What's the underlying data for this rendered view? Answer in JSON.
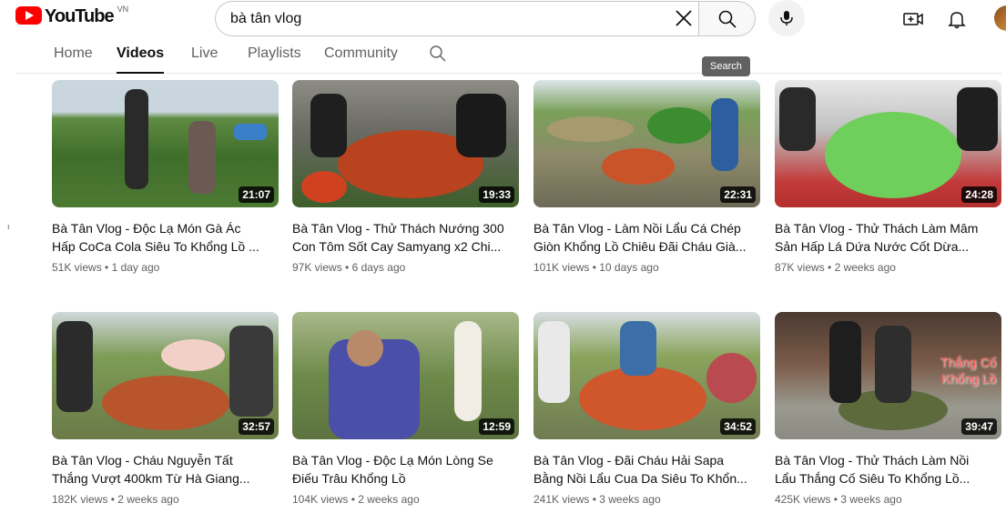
{
  "header": {
    "logo_text": "YouTube",
    "region": "VN",
    "search_value": "bà tân vlog",
    "search_tooltip": "Search"
  },
  "tabs": [
    {
      "label": "Home"
    },
    {
      "label": "Videos"
    },
    {
      "label": "Live"
    },
    {
      "label": "Playlists"
    },
    {
      "label": "Community"
    }
  ],
  "videos": [
    {
      "title": "Bà Tân Vlog - Độc Lạ Món Gà Ác Hấp CoCa Cola Siêu To Khổng Lồ ...",
      "duration": "21:07",
      "views": "51K views",
      "age": "1 day ago"
    },
    {
      "title": "Bà Tân Vlog - Thử Thách Nướng 300 Con Tôm Sốt Cay Samyang x2 Chi...",
      "duration": "19:33",
      "views": "97K views",
      "age": "6 days ago"
    },
    {
      "title": "Bà Tân Vlog - Làm Nồi Lẩu Cá Chép Giòn Khổng Lồ Chiêu Đãi Cháu Già...",
      "duration": "22:31",
      "views": "101K views",
      "age": "10 days ago"
    },
    {
      "title": "Bà Tân Vlog - Thử Thách Làm Mâm Sản Hấp Lá Dứa Nước Cốt Dừa...",
      "duration": "24:28",
      "views": "87K views",
      "age": "2 weeks ago"
    },
    {
      "title": "Bà Tân Vlog - Cháu Nguyễn Tất Thắng Vượt 400km Từ Hà Giang...",
      "duration": "32:57",
      "views": "182K views",
      "age": "2 weeks ago"
    },
    {
      "title": "Bà Tân Vlog - Độc Lạ Món Lòng Se Điếu Trâu Khổng Lồ",
      "duration": "12:59",
      "views": "104K views",
      "age": "2 weeks ago"
    },
    {
      "title": "Bà Tân Vlog - Đãi Cháu Hải Sapa Bằng Nồi Lẩu Cua Da Siêu To Khổn...",
      "duration": "34:52",
      "views": "241K views",
      "age": "3 weeks ago"
    },
    {
      "title": "Bà Tân Vlog - Thử Thách Làm Nồi Lẩu Thắng Cố Siêu To Khổng Lồ...",
      "duration": "39:47",
      "views": "425K views",
      "age": "3 weeks ago",
      "overlay_line1": "Thắng Cố",
      "overlay_line2": "Khổng Lồ"
    }
  ],
  "colors": {
    "brand": "#ff0000",
    "text": "#0f0f0f",
    "muted": "#606060"
  },
  "icons": [
    "clear-icon",
    "search-icon",
    "mic-icon",
    "create-icon",
    "bell-icon"
  ]
}
